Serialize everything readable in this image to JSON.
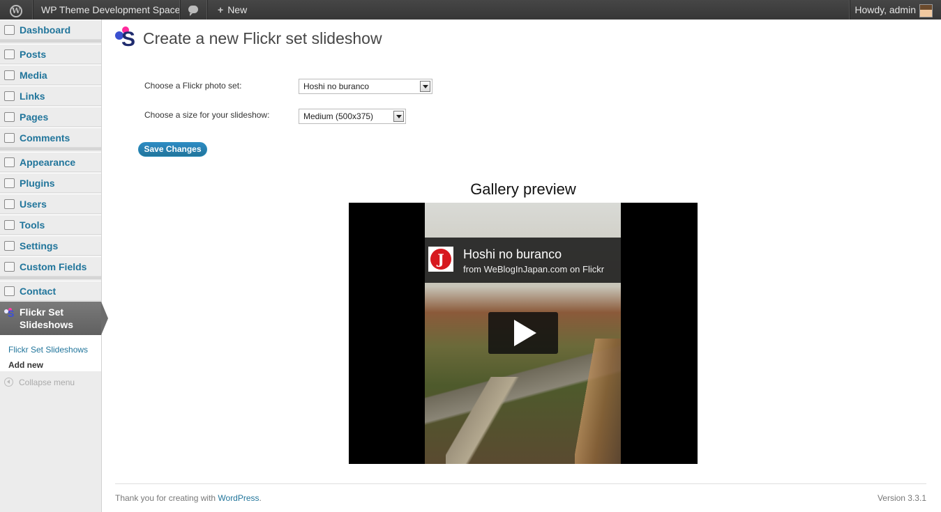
{
  "adminbar": {
    "site_name": "WP Theme Development Space",
    "new_label": "New",
    "new_plus": "+",
    "howdy": "Howdy, admin",
    "wp_logo_letter": "W"
  },
  "sidebar": {
    "items": [
      {
        "label": "Dashboard"
      },
      {
        "label": "Posts"
      },
      {
        "label": "Media"
      },
      {
        "label": "Links"
      },
      {
        "label": "Pages"
      },
      {
        "label": "Comments"
      },
      {
        "label": "Appearance"
      },
      {
        "label": "Plugins"
      },
      {
        "label": "Users"
      },
      {
        "label": "Tools"
      },
      {
        "label": "Settings"
      },
      {
        "label": "Custom Fields"
      },
      {
        "label": "Contact"
      }
    ],
    "active": {
      "line1": "Flickr Set",
      "line2": "Slideshows",
      "icon_letter": "S"
    },
    "submenu": [
      {
        "label": "Flickr Set Slideshows"
      },
      {
        "label": "Add new"
      }
    ],
    "collapse_label": "Collapse menu"
  },
  "page": {
    "logo_letter": "S",
    "title": "Create a new Flickr set slideshow",
    "photoset_label": "Choose a Flickr photo set:",
    "photoset_value": "Hoshi no buranco",
    "size_label": "Choose a size for your slideshow:",
    "size_value": "Medium (500x375)",
    "save_label": "Save Changes",
    "preview_title": "Gallery preview"
  },
  "player": {
    "title": "Hoshi no buranco",
    "subtitle": "from WeBlogInJapan.com on Flickr",
    "icon_letter": "J"
  },
  "footer": {
    "thanks": "Thank you for creating with ",
    "link": "WordPress",
    "period": ".",
    "version": "Version 3.3.1"
  },
  "colors": {
    "link": "#21759b",
    "adminbar_bg": "#464646",
    "sidebar_bg": "#ececec",
    "active_menu_bg": "#6d6d6d",
    "button_bg": "#21759b"
  }
}
